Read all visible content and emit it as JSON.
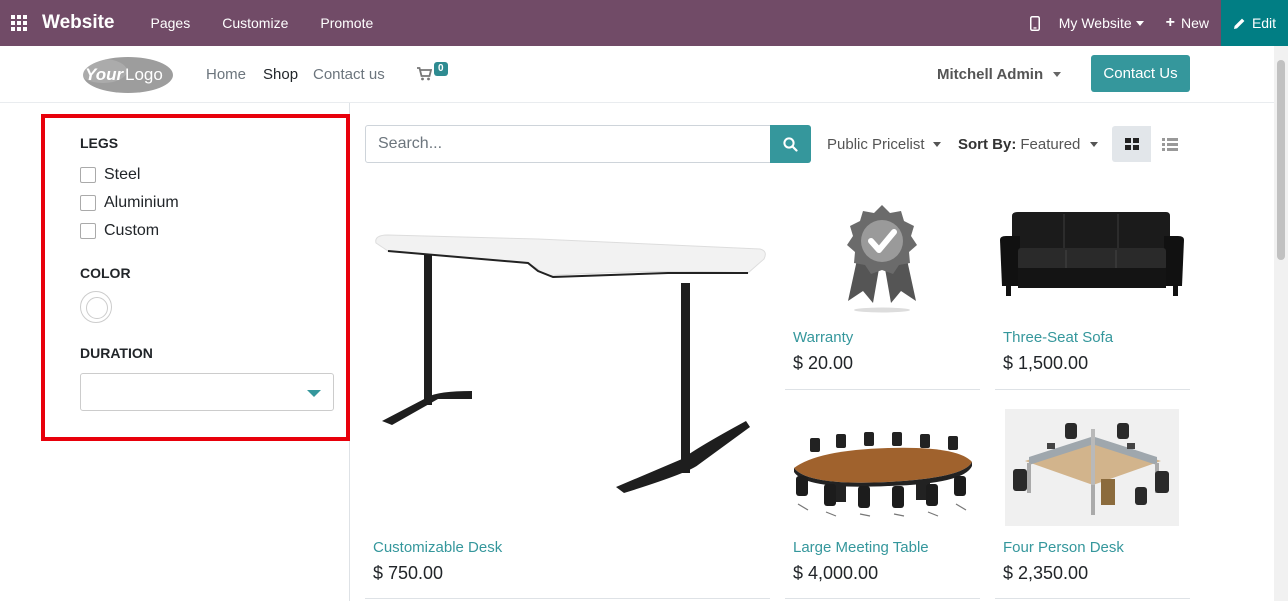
{
  "topbar": {
    "brand": "Website",
    "menu": [
      "Pages",
      "Customize",
      "Promote"
    ],
    "my_website": "My Website",
    "new_label": "New",
    "edit_label": "Edit"
  },
  "header": {
    "logo_text": "YourLogo",
    "nav": [
      "Home",
      "Shop",
      "Contact us"
    ],
    "cart_count": "0",
    "user": "Mitchell Admin",
    "contact_button": "Contact Us"
  },
  "filters": {
    "legs_title": "LEGS",
    "legs_options": [
      "Steel",
      "Aluminium",
      "Custom"
    ],
    "color_title": "COLOR",
    "duration_title": "DURATION",
    "duration_value": ""
  },
  "toolbar": {
    "search_placeholder": "Search...",
    "pricelist": "Public Pricelist",
    "sort_label": "Sort By:",
    "sort_value": "Featured"
  },
  "products": [
    {
      "name": "Customizable Desk",
      "price": "$ 750.00"
    },
    {
      "name": "Warranty",
      "price": "$ 20.00"
    },
    {
      "name": "Three-Seat Sofa",
      "price": "$ 1,500.00"
    },
    {
      "name": "Large Meeting Table",
      "price": "$ 4,000.00"
    },
    {
      "name": "Four Person Desk",
      "price": "$ 2,350.00"
    }
  ],
  "colors": {
    "admin_bar": "#714b67",
    "edit_button": "#017e84",
    "accent": "#35979c",
    "highlight": "#e8000b"
  }
}
